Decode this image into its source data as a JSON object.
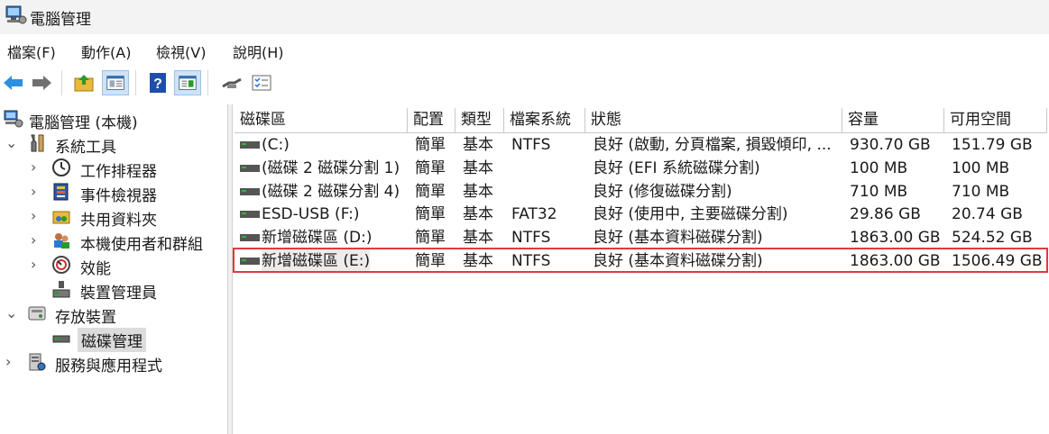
{
  "window": {
    "title": "電腦管理"
  },
  "menu": [
    "檔案(F)",
    "動作(A)",
    "檢視(V)",
    "說明(H)"
  ],
  "toolbar": {
    "icons": [
      "back-arrow-icon",
      "forward-arrow-icon",
      "up-folder-icon",
      "show-hide-tree-icon",
      "help-icon",
      "show-action-pane-icon",
      "connect-icon",
      "properties-icon"
    ]
  },
  "tree": {
    "root": "電腦管理 (本機)",
    "system_tools": "系統工具",
    "task_scheduler": "工作排程器",
    "event_viewer": "事件檢視器",
    "shared_folders": "共用資料夾",
    "local_users": "本機使用者和群組",
    "performance": "效能",
    "device_manager": "裝置管理員",
    "storage": "存放裝置",
    "disk_management": "磁碟管理",
    "services_apps": "服務與應用程式"
  },
  "columns": {
    "volume": "磁碟區",
    "layout": "配置",
    "type": "類型",
    "fs": "檔案系統",
    "status": "狀態",
    "capacity": "容量",
    "free": "可用空間"
  },
  "rows": [
    {
      "volume": "(C:)",
      "layout": "簡單",
      "type": "基本",
      "fs": "NTFS",
      "status": "良好 (啟動, 分頁檔案, 損毀傾印, ...",
      "capacity": "930.70 GB",
      "free": "151.79 GB"
    },
    {
      "volume": "(磁碟 2 磁碟分割 1)",
      "layout": "簡單",
      "type": "基本",
      "fs": "",
      "status": "良好 (EFI 系統磁碟分割)",
      "capacity": "100 MB",
      "free": "100 MB"
    },
    {
      "volume": "(磁碟 2 磁碟分割 4)",
      "layout": "簡單",
      "type": "基本",
      "fs": "",
      "status": "良好 (修復磁碟分割)",
      "capacity": "710 MB",
      "free": "710 MB"
    },
    {
      "volume": "ESD-USB (F:)",
      "layout": "簡單",
      "type": "基本",
      "fs": "FAT32",
      "status": "良好 (使用中, 主要磁碟分割)",
      "capacity": "29.86 GB",
      "free": "20.74 GB"
    },
    {
      "volume": "新增磁碟區 (D:)",
      "layout": "簡單",
      "type": "基本",
      "fs": "NTFS",
      "status": "良好 (基本資料磁碟分割)",
      "capacity": "1863.00 GB",
      "free": "524.52 GB"
    },
    {
      "volume": "新增磁碟區 (E:)",
      "layout": "簡單",
      "type": "基本",
      "fs": "NTFS",
      "status": "良好 (基本資料磁碟分割)",
      "capacity": "1863.00 GB",
      "free": "1506.49 GB"
    }
  ],
  "colors": {
    "highlight": "#e23a3a",
    "selected_bg": "#dcdcdc"
  }
}
